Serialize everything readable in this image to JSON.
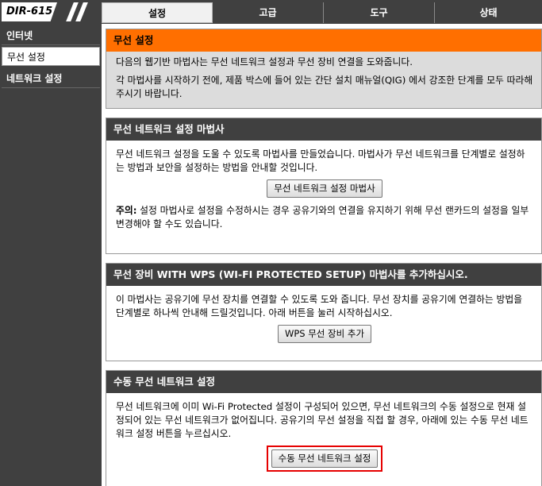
{
  "model": "DIR-615",
  "tabs": [
    {
      "label": "설정",
      "active": true
    },
    {
      "label": "고급",
      "active": false
    },
    {
      "label": "도구",
      "active": false
    },
    {
      "label": "상태",
      "active": false
    }
  ],
  "sidebar": {
    "items": [
      {
        "label": "인터넷",
        "active": false
      },
      {
        "label": "무선 설정",
        "active": true
      },
      {
        "label": "네트워크 설정",
        "active": false
      }
    ]
  },
  "intro": {
    "title": "무선 설정",
    "line1": "다음의 웹기반 마법사는 무선 네트워크 설정과 무선 장비 연결을 도와줍니다.",
    "line2": "각 마법사를 시작하기 전에, 제품 박스에 들어 있는 간단 설치 매뉴얼(QIG) 에서 강조한 단계를 모두 따라해 주시기 바랍니다."
  },
  "wizard": {
    "title": "무선 네트워크 설정 마법사",
    "text": "무선 네트워크 설정을 도울 수 있도록 마법사를 만들었습니다. 마법사가 무선 네트워크를 단계별로 설정하는 방법과 보안을 설정하는 방법을 안내할 것입니다.",
    "button": "무선 네트워크 설정 마법사",
    "note_label": "주의:",
    "note_text": " 설정 마법사로 설정을 수정하시는 경우 공유기와의 연결을 유지하기 위해 무선 랜카드의 설정을 일부 변경해야 할 수도 있습니다."
  },
  "wps": {
    "title": "무선 장비 WITH WPS (WI-FI PROTECTED SETUP) 마법사를 추가하십시오.",
    "text": "이 마법사는 공유기에 무선 장치를 연결할 수 있도록 도와 줍니다. 무선 장치를 공유기에 연결하는 방법을 단계별로 하나씩 안내해 드릴것입니다. 아래 버튼을 눌러 시작하십시오.",
    "button": "WPS 무선 장비 추가"
  },
  "manual": {
    "title": "수동 무선 네트워크 설정",
    "text": "무선 네트워크에 이미 Wi-Fi Protected 설정이 구성되어 있으면, 무선 네트워크의 수동 설정으로 현재 설정되어 있는 무선 네트워크가 없어집니다. 공유기의 무선 설정을 직접 할 경우, 아래에 있는 수동 무선 네트워크 설정 버튼을 누르십시오.",
    "button": "수동 무선 네트워크 설정"
  },
  "colors": {
    "accent": "#ff6f00",
    "dark": "#404040",
    "highlight": "#e60000"
  }
}
